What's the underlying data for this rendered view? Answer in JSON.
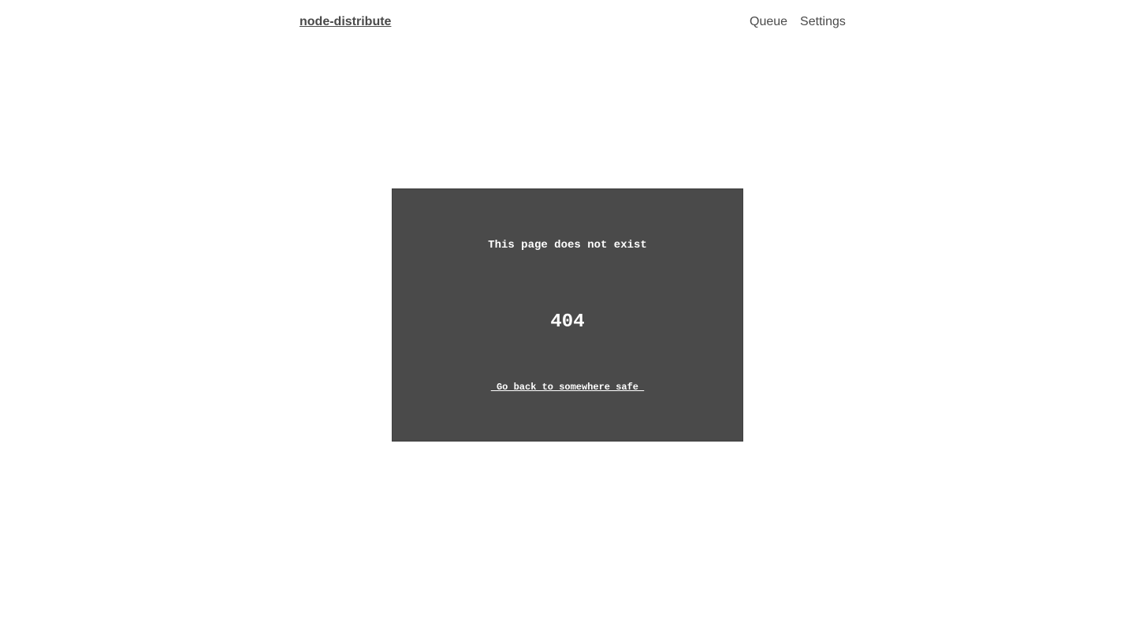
{
  "header": {
    "brand": "node-distribute",
    "nav": {
      "queue": "Queue",
      "settings": "Settings"
    }
  },
  "error": {
    "message": "This page does not exist",
    "code": "404",
    "back_link": " Go back to somewhere safe "
  },
  "colors": {
    "text": "#4a4a4a",
    "card_background": "#4a4a4a",
    "card_text": "#ffffff",
    "page_background": "#ffffff"
  }
}
